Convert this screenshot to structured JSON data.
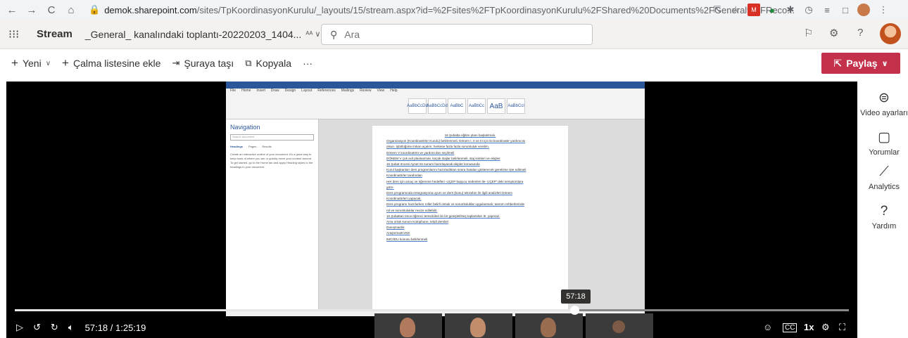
{
  "browser": {
    "url_host": "demok.sharepoint.com",
    "url_path": "/sites/TpKoordinasyonKurulu/_layouts/15/stream.aspx?id=%2Fsites%2FTpKoordinasyonKurulu%2FShared%20Documents%2FGeneral%2FReco..."
  },
  "header": {
    "app_name": "Stream",
    "doc_title": "_General_ kanalındaki toplantı-20220203_1404...",
    "search_placeholder": "Ara"
  },
  "commands": {
    "new_label": "Yeni",
    "playlist_label": "Çalma listesine ekle",
    "move_label": "Şuraya taşı",
    "copy_label": "Kopyala",
    "more_label": "···",
    "share_label": "Paylaş"
  },
  "player": {
    "tooltip_time": "57:18",
    "time_display": "57:18 / 1:25:19",
    "progress": 0.671,
    "speed_label": "1x",
    "cc_label": "CC"
  },
  "rail": {
    "video_settings": "Video ayarları",
    "comments": "Yorumlar",
    "analytics": "Analytics",
    "help": "Yardım"
  },
  "shared_screen": {
    "nav_title": "Navigation",
    "nav_search": "Search document",
    "nav_tabs": [
      "Headings",
      "Pages",
      "Results"
    ],
    "nav_text": "Create an interactive outline of your document. It's a great way to keep track of where you are or quickly move your content around. To get started, go to the Home tab and apply Heading styles to the headings in your document.",
    "doc_lines": [
      "16 Şubatta eğitim planı başlatılmalı.",
      "Organizasyon (Koordinatörler Kurulu) belirlenmeli. Dönem I, II ve III için iki koordinatör yardımcısı",
      "olsun. İşbölüğüne imkan açalım; herkese fazla fazla sorumluluk verelim.",
      "Dönem V koordinatörü ve yardımcıları seçilmeli",
      "DÖNEM V çok acil planlanmalı, küçük stajlar belirlenmeli, staj isimleri ve ekipler",
      "16 Şubat öncesi Aynet ön sunum hazırlayacak ekipler konusunda",
      "Kurul başkanları ders programlarını hazırladıktan sonra hataları gösterecek gerekirse işte editmeli",
      "Koordinatörler tarafından",
      "Her ders için amaç ve öğrenme hedefleri -UÇEP başucu nedenleri ile- UÇEP' deki semptomlara",
      "göre-",
      "Ders programında entegrasyona uyum ve ders (konu) tekrarları ile ilgili analizleri Dönem",
      "Koordinatörleri yapacak.",
      "Ders programı hazırlarken roller belirli olmalı ve sorumluluklar uygulanmalı; tanıtım rehberlerinde",
      "rol ve sorumluluklar revize edilebilir.",
      "16 Şubattan önce öğrenci temsilcileri ile bir genişletilmiş toplantıları III. yapmaz.",
      "Ama ortak sunum Kütüphane, telafi dersleri",
      "Danışmanlık",
      "Araştırma/KVKK",
      "IMCI/DU konusu belirlenmeli"
    ]
  }
}
